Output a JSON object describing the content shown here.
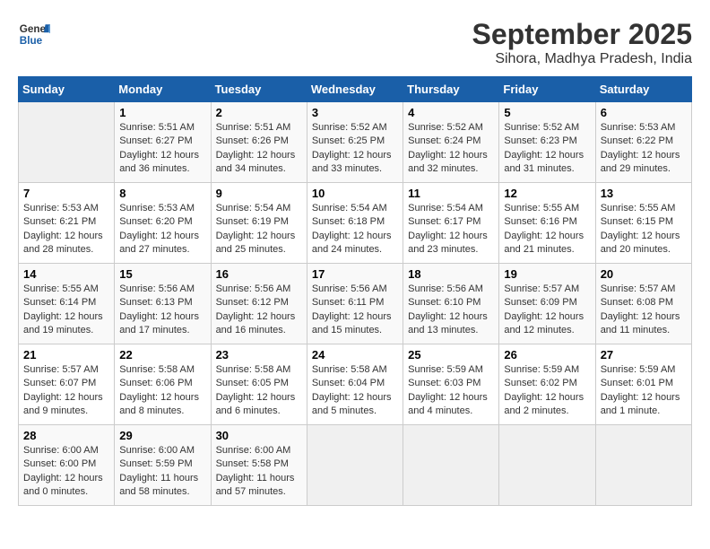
{
  "header": {
    "logo_line1": "General",
    "logo_line2": "Blue",
    "month": "September 2025",
    "location": "Sihora, Madhya Pradesh, India"
  },
  "weekdays": [
    "Sunday",
    "Monday",
    "Tuesday",
    "Wednesday",
    "Thursday",
    "Friday",
    "Saturday"
  ],
  "weeks": [
    [
      {
        "day": "",
        "sunrise": "",
        "sunset": "",
        "daylight": ""
      },
      {
        "day": "1",
        "sunrise": "Sunrise: 5:51 AM",
        "sunset": "Sunset: 6:27 PM",
        "daylight": "Daylight: 12 hours and 36 minutes."
      },
      {
        "day": "2",
        "sunrise": "Sunrise: 5:51 AM",
        "sunset": "Sunset: 6:26 PM",
        "daylight": "Daylight: 12 hours and 34 minutes."
      },
      {
        "day": "3",
        "sunrise": "Sunrise: 5:52 AM",
        "sunset": "Sunset: 6:25 PM",
        "daylight": "Daylight: 12 hours and 33 minutes."
      },
      {
        "day": "4",
        "sunrise": "Sunrise: 5:52 AM",
        "sunset": "Sunset: 6:24 PM",
        "daylight": "Daylight: 12 hours and 32 minutes."
      },
      {
        "day": "5",
        "sunrise": "Sunrise: 5:52 AM",
        "sunset": "Sunset: 6:23 PM",
        "daylight": "Daylight: 12 hours and 31 minutes."
      },
      {
        "day": "6",
        "sunrise": "Sunrise: 5:53 AM",
        "sunset": "Sunset: 6:22 PM",
        "daylight": "Daylight: 12 hours and 29 minutes."
      }
    ],
    [
      {
        "day": "7",
        "sunrise": "Sunrise: 5:53 AM",
        "sunset": "Sunset: 6:21 PM",
        "daylight": "Daylight: 12 hours and 28 minutes."
      },
      {
        "day": "8",
        "sunrise": "Sunrise: 5:53 AM",
        "sunset": "Sunset: 6:20 PM",
        "daylight": "Daylight: 12 hours and 27 minutes."
      },
      {
        "day": "9",
        "sunrise": "Sunrise: 5:54 AM",
        "sunset": "Sunset: 6:19 PM",
        "daylight": "Daylight: 12 hours and 25 minutes."
      },
      {
        "day": "10",
        "sunrise": "Sunrise: 5:54 AM",
        "sunset": "Sunset: 6:18 PM",
        "daylight": "Daylight: 12 hours and 24 minutes."
      },
      {
        "day": "11",
        "sunrise": "Sunrise: 5:54 AM",
        "sunset": "Sunset: 6:17 PM",
        "daylight": "Daylight: 12 hours and 23 minutes."
      },
      {
        "day": "12",
        "sunrise": "Sunrise: 5:55 AM",
        "sunset": "Sunset: 6:16 PM",
        "daylight": "Daylight: 12 hours and 21 minutes."
      },
      {
        "day": "13",
        "sunrise": "Sunrise: 5:55 AM",
        "sunset": "Sunset: 6:15 PM",
        "daylight": "Daylight: 12 hours and 20 minutes."
      }
    ],
    [
      {
        "day": "14",
        "sunrise": "Sunrise: 5:55 AM",
        "sunset": "Sunset: 6:14 PM",
        "daylight": "Daylight: 12 hours and 19 minutes."
      },
      {
        "day": "15",
        "sunrise": "Sunrise: 5:56 AM",
        "sunset": "Sunset: 6:13 PM",
        "daylight": "Daylight: 12 hours and 17 minutes."
      },
      {
        "day": "16",
        "sunrise": "Sunrise: 5:56 AM",
        "sunset": "Sunset: 6:12 PM",
        "daylight": "Daylight: 12 hours and 16 minutes."
      },
      {
        "day": "17",
        "sunrise": "Sunrise: 5:56 AM",
        "sunset": "Sunset: 6:11 PM",
        "daylight": "Daylight: 12 hours and 15 minutes."
      },
      {
        "day": "18",
        "sunrise": "Sunrise: 5:56 AM",
        "sunset": "Sunset: 6:10 PM",
        "daylight": "Daylight: 12 hours and 13 minutes."
      },
      {
        "day": "19",
        "sunrise": "Sunrise: 5:57 AM",
        "sunset": "Sunset: 6:09 PM",
        "daylight": "Daylight: 12 hours and 12 minutes."
      },
      {
        "day": "20",
        "sunrise": "Sunrise: 5:57 AM",
        "sunset": "Sunset: 6:08 PM",
        "daylight": "Daylight: 12 hours and 11 minutes."
      }
    ],
    [
      {
        "day": "21",
        "sunrise": "Sunrise: 5:57 AM",
        "sunset": "Sunset: 6:07 PM",
        "daylight": "Daylight: 12 hours and 9 minutes."
      },
      {
        "day": "22",
        "sunrise": "Sunrise: 5:58 AM",
        "sunset": "Sunset: 6:06 PM",
        "daylight": "Daylight: 12 hours and 8 minutes."
      },
      {
        "day": "23",
        "sunrise": "Sunrise: 5:58 AM",
        "sunset": "Sunset: 6:05 PM",
        "daylight": "Daylight: 12 hours and 6 minutes."
      },
      {
        "day": "24",
        "sunrise": "Sunrise: 5:58 AM",
        "sunset": "Sunset: 6:04 PM",
        "daylight": "Daylight: 12 hours and 5 minutes."
      },
      {
        "day": "25",
        "sunrise": "Sunrise: 5:59 AM",
        "sunset": "Sunset: 6:03 PM",
        "daylight": "Daylight: 12 hours and 4 minutes."
      },
      {
        "day": "26",
        "sunrise": "Sunrise: 5:59 AM",
        "sunset": "Sunset: 6:02 PM",
        "daylight": "Daylight: 12 hours and 2 minutes."
      },
      {
        "day": "27",
        "sunrise": "Sunrise: 5:59 AM",
        "sunset": "Sunset: 6:01 PM",
        "daylight": "Daylight: 12 hours and 1 minute."
      }
    ],
    [
      {
        "day": "28",
        "sunrise": "Sunrise: 6:00 AM",
        "sunset": "Sunset: 6:00 PM",
        "daylight": "Daylight: 12 hours and 0 minutes."
      },
      {
        "day": "29",
        "sunrise": "Sunrise: 6:00 AM",
        "sunset": "Sunset: 5:59 PM",
        "daylight": "Daylight: 11 hours and 58 minutes."
      },
      {
        "day": "30",
        "sunrise": "Sunrise: 6:00 AM",
        "sunset": "Sunset: 5:58 PM",
        "daylight": "Daylight: 11 hours and 57 minutes."
      },
      {
        "day": "",
        "sunrise": "",
        "sunset": "",
        "daylight": ""
      },
      {
        "day": "",
        "sunrise": "",
        "sunset": "",
        "daylight": ""
      },
      {
        "day": "",
        "sunrise": "",
        "sunset": "",
        "daylight": ""
      },
      {
        "day": "",
        "sunrise": "",
        "sunset": "",
        "daylight": ""
      }
    ]
  ]
}
